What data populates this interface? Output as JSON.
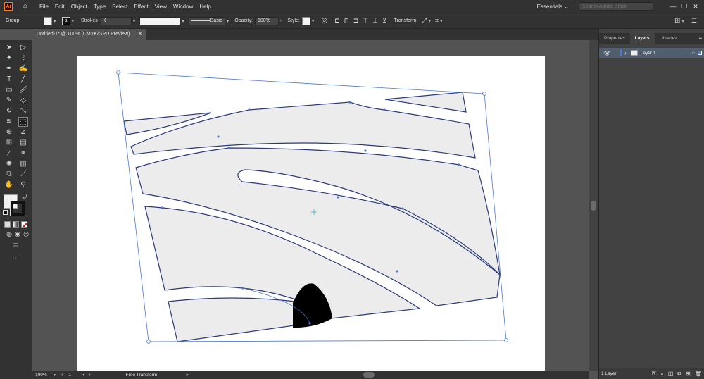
{
  "app": {
    "logo": "Ai",
    "home_icon": "home-icon"
  },
  "menu": [
    "File",
    "Edit",
    "Object",
    "Type",
    "Select",
    "Effect",
    "View",
    "Window",
    "Help"
  ],
  "workspace": {
    "label": "Essentials",
    "chevron": "⌄"
  },
  "search": {
    "placeholder": "Search Adobe Stock"
  },
  "window_buttons": {
    "minimize": "—",
    "restore": "❐",
    "close": "✕"
  },
  "control": {
    "selection_type": "Group",
    "strokes_label": "Strokes",
    "brush_label": "Basic",
    "opacity_label": "Opacity:",
    "opacity_value": "100%",
    "style_label": "Style:",
    "transform_label": "Transform",
    "stroke_box_glyph": "a"
  },
  "document": {
    "tab_title": "Untitled-1* @ 100% (CMYK/GPU Preview)",
    "close": "✕"
  },
  "status": {
    "zoom": "100%",
    "artboard_number": "1",
    "tool_status": "Free Transform"
  },
  "panel": {
    "tabs": [
      "Properties",
      "Layers",
      "Libraries"
    ],
    "active_tab": "Layers",
    "layers": [
      {
        "name": "Layer 1"
      }
    ],
    "footer_count": "1 Layer"
  },
  "colors": {
    "accent": "#4a78d6",
    "fill_shape": "#ececec",
    "stroke_shape": "#2b3a7a"
  }
}
